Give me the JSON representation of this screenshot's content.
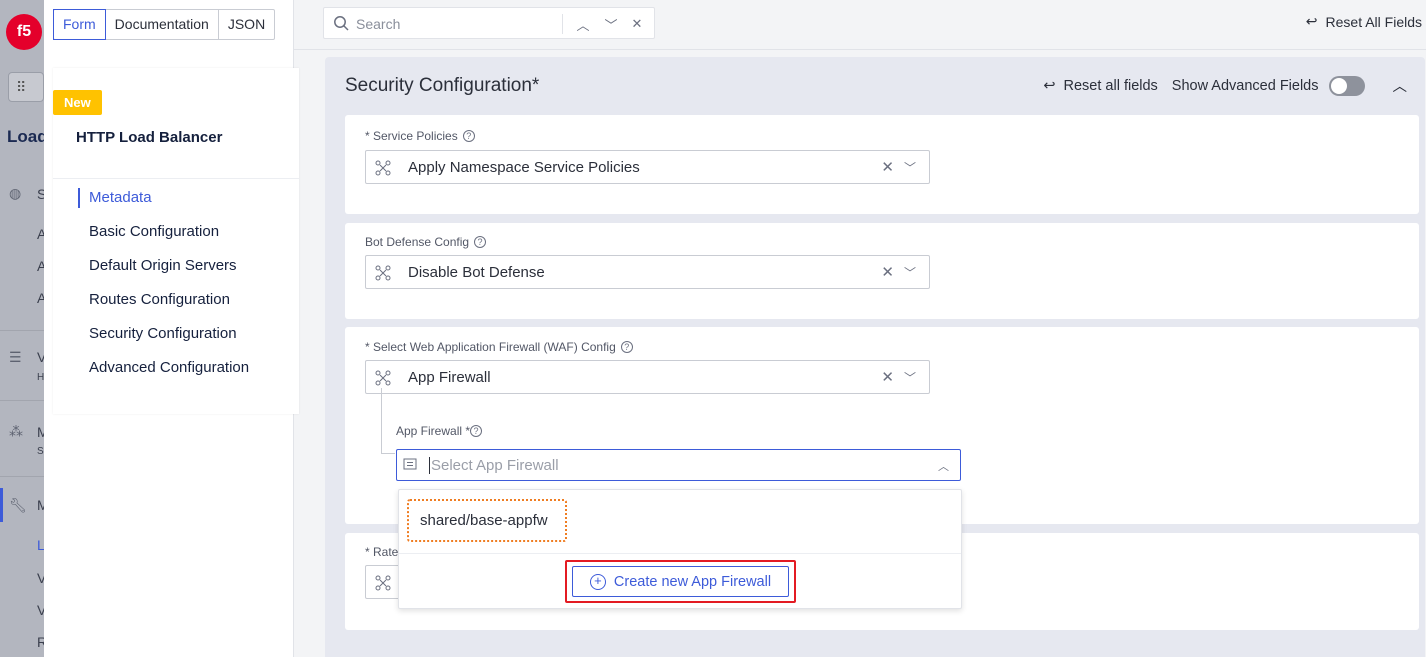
{
  "app_nav": {
    "logo": "f5",
    "section_label": "Load",
    "items": [
      {
        "label": "S"
      },
      {
        "label": "A"
      },
      {
        "label": "A"
      },
      {
        "label": "A"
      },
      {
        "label": "V",
        "sub": "H"
      },
      {
        "label": "M",
        "sub": "S"
      },
      {
        "label": "M"
      },
      {
        "label": "L"
      },
      {
        "label": "V"
      },
      {
        "label": "V"
      },
      {
        "label": "R"
      }
    ]
  },
  "tabs": [
    {
      "label": "Form"
    },
    {
      "label": "Documentation"
    },
    {
      "label": "JSON"
    }
  ],
  "nav_card": {
    "badge": "New",
    "title": "HTTP Load Balancer",
    "toc": [
      {
        "label": "Metadata"
      },
      {
        "label": "Basic Configuration"
      },
      {
        "label": "Default Origin Servers"
      },
      {
        "label": "Routes Configuration"
      },
      {
        "label": "Security Configuration"
      },
      {
        "label": "Advanced Configuration"
      }
    ]
  },
  "search": {
    "placeholder": "Search"
  },
  "toolbar": {
    "reset_all": "Reset All Fields"
  },
  "section": {
    "title": "Security Configuration*",
    "reset_label": "Reset all fields",
    "advanced_label": "Show Advanced Fields",
    "advanced_enabled": false,
    "fields": {
      "service_policies": {
        "label": "* Service Policies",
        "value": "Apply Namespace Service Policies"
      },
      "bot_defense": {
        "label": "Bot Defense Config",
        "value": "Disable Bot Defense"
      },
      "waf": {
        "label": "* Select Web Application Firewall (WAF) Config",
        "value": "App Firewall"
      },
      "app_firewall": {
        "label": "App Firewall *",
        "placeholder": "Select App Firewall"
      },
      "rate": {
        "label": "* Rate"
      }
    }
  },
  "dropdown": {
    "options": [
      "shared/base-appfw"
    ],
    "create_label": "Create new App Firewall"
  },
  "colors": {
    "accent": "#3d5bd9",
    "highlight_orange": "#ef7d22",
    "highlight_red": "#e31b23",
    "badge": "#ffc200"
  }
}
